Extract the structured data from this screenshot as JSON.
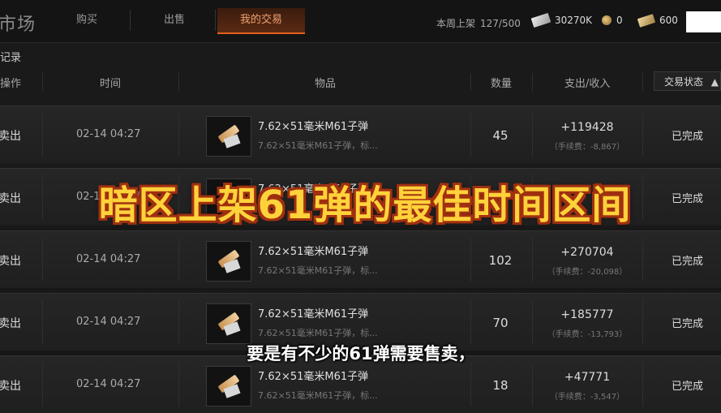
{
  "header": {
    "title": "市场",
    "tabs": [
      {
        "label": "购买"
      },
      {
        "label": "出售"
      },
      {
        "label": "我的交易",
        "active": true
      }
    ],
    "weekly_label": "本周上架",
    "weekly_count": "127/500",
    "currencies": [
      {
        "icon": "cash-icon",
        "value": "30270K"
      },
      {
        "icon": "coin-icon",
        "value": "0"
      },
      {
        "icon": "gold-bar-icon",
        "value": "600"
      }
    ]
  },
  "section_label": "记录",
  "columns": {
    "action": "操作",
    "time": "时间",
    "item": "物品",
    "quantity": "数量",
    "income": "支出/收入",
    "status": "交易状态"
  },
  "rows": [
    {
      "action": "卖出",
      "time": "02-14 04:27",
      "item_name": "7.62×51毫米M61子弹",
      "item_desc": "7.62×51毫米M61子弹，标...",
      "quantity": "45",
      "income": "+119428",
      "fee": "（手续费：-8,867）",
      "status": "已完成"
    },
    {
      "action": "卖出",
      "time": "02-14 04:27",
      "item_name": "7.62×51毫米M61子弹",
      "item_desc": "",
      "quantity": "",
      "income": "",
      "fee": "",
      "status": "已完成"
    },
    {
      "action": "卖出",
      "time": "02-14 04:27",
      "item_name": "7.62×51毫米M61子弹",
      "item_desc": "7.62×51毫米M61子弹，标...",
      "quantity": "102",
      "income": "+270704",
      "fee": "（手续费：-20,098）",
      "status": "已完成"
    },
    {
      "action": "卖出",
      "time": "02-14 04:27",
      "item_name": "7.62×51毫米M61子弹",
      "item_desc": "7.62×51毫米M61子弹，标...",
      "quantity": "70",
      "income": "+185777",
      "fee": "（手续费：-13,793）",
      "status": "已完成"
    },
    {
      "action": "卖出",
      "time": "02-14 04:27",
      "item_name": "7.62×51毫米M61子弹",
      "item_desc": "7.62×51毫米M61子弹，标...",
      "quantity": "18",
      "income": "+47771",
      "fee": "（手续费：-3,547）",
      "status": "已完成"
    }
  ],
  "overlay": {
    "title": "暗区上架61弹的最佳时间区间",
    "subtitle": "要是有不少的61弹需要售卖，"
  },
  "colors": {
    "accent": "#e06020",
    "overlay_text": "#ffd23a",
    "overlay_outline": "#a03010"
  }
}
